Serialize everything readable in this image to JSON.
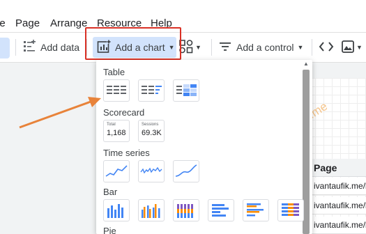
{
  "menubar": {
    "items": [
      "le",
      "Page",
      "Arrange",
      "Resource",
      "Help"
    ]
  },
  "toolbar": {
    "add_data": "Add data",
    "add_chart": "Add a chart",
    "add_control": "Add a control"
  },
  "dropdown": {
    "sections": {
      "table": "Table",
      "scorecard": "Scorecard",
      "time_series": "Time series",
      "bar": "Bar",
      "pie": "Pie"
    },
    "scorecards": [
      {
        "label": "Total",
        "value": "1,168"
      },
      {
        "label": "Sessions",
        "value": "69.3K"
      }
    ]
  },
  "table": {
    "header": "Page",
    "rows": [
      "ivantaufik.me/b",
      "ivantaufik.me/b",
      "ivantaufik.me/b"
    ]
  },
  "watermark": "ivantaufik.me",
  "colors": {
    "accent": "#d2e3fc",
    "highlight": "#d93025",
    "arrow": "#e8833a",
    "bar_blue": "#4285f4",
    "bar_orange": "#fb8c00",
    "bar_purple": "#7e57c2"
  },
  "icons": [
    "add-data-icon",
    "add-chart-icon",
    "community-viz-icon",
    "filter-icon",
    "code-icon",
    "image-icon",
    "caret-down-icon"
  ]
}
